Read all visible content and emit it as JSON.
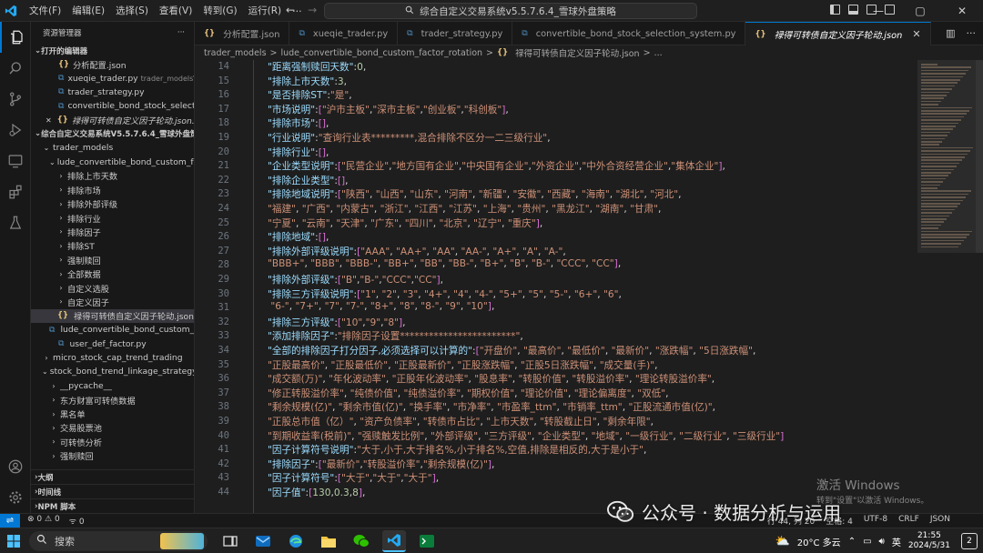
{
  "titlebar": {
    "menus": [
      "文件(F)",
      "编辑(E)",
      "选择(S)",
      "查看(V)",
      "转到(G)",
      "运行(R)"
    ],
    "more": "…",
    "command_center": "综合自定义交易系统v5.5.7.6.4_雪球外盘策略"
  },
  "sidebar": {
    "title": "资源管理器",
    "more": "···",
    "open_editors_label": "打开的编辑器",
    "open_editors": [
      {
        "icon": "json",
        "name": "分析配置.json",
        "hint": ""
      },
      {
        "icon": "py",
        "name": "xueqie_trader.py",
        "hint": "trader_models\\..."
      },
      {
        "icon": "py",
        "name": "trader_strategy.py",
        "hint": ""
      },
      {
        "icon": "py",
        "name": "convertible_bond_stock_selecti...",
        "hint": ""
      },
      {
        "icon": "json",
        "name": "禄得可转债自定义因子轮动.json...",
        "hint": ""
      }
    ],
    "project_label": "综合自定义交易系统V5.5.7.6.4_雪球外盘策略",
    "tree": [
      {
        "level": 1,
        "twisty": "v",
        "name": "trader_models",
        "icon": ""
      },
      {
        "level": 2,
        "twisty": "v",
        "name": "lude_convertible_bond_custom_fac...",
        "icon": ""
      },
      {
        "level": 3,
        "twisty": ">",
        "name": "排除上市天数",
        "icon": ""
      },
      {
        "level": 3,
        "twisty": ">",
        "name": "排除市场",
        "icon": ""
      },
      {
        "level": 3,
        "twisty": ">",
        "name": "排除外部评级",
        "icon": ""
      },
      {
        "level": 3,
        "twisty": ">",
        "name": "排除行业",
        "icon": ""
      },
      {
        "level": 3,
        "twisty": ">",
        "name": "排除因子",
        "icon": ""
      },
      {
        "level": 3,
        "twisty": ">",
        "name": "排除ST",
        "icon": ""
      },
      {
        "level": 3,
        "twisty": ">",
        "name": "强制赎回",
        "icon": ""
      },
      {
        "level": 3,
        "twisty": ">",
        "name": "全部数据",
        "icon": ""
      },
      {
        "level": 3,
        "twisty": ">",
        "name": "自定义选股",
        "icon": ""
      },
      {
        "level": 3,
        "twisty": ">",
        "name": "自定义因子",
        "icon": ""
      },
      {
        "level": 3,
        "twisty": "",
        "name": "禄得可转债自定义因子轮动.json",
        "icon": "json",
        "selected": true
      },
      {
        "level": 2,
        "twisty": "",
        "name": "lude_convertible_bond_custom_fa...",
        "icon": "py"
      },
      {
        "level": 2,
        "twisty": "",
        "name": "user_def_factor.py",
        "icon": "py"
      },
      {
        "level": 1,
        "twisty": ">",
        "name": "micro_stock_cap_trend_trading",
        "icon": ""
      },
      {
        "level": 1,
        "twisty": "v",
        "name": "stock_bond_trend_linkage_strategy",
        "icon": ""
      },
      {
        "level": 2,
        "twisty": ">",
        "name": "__pycache__",
        "icon": ""
      },
      {
        "level": 2,
        "twisty": ">",
        "name": "东方财富可转债数据",
        "icon": ""
      },
      {
        "level": 2,
        "twisty": ">",
        "name": "黑名单",
        "icon": ""
      },
      {
        "level": 2,
        "twisty": ">",
        "name": "交易股票池",
        "icon": ""
      },
      {
        "level": 2,
        "twisty": ">",
        "name": "可转债分析",
        "icon": ""
      },
      {
        "level": 2,
        "twisty": ">",
        "name": "强制赎回",
        "icon": ""
      }
    ],
    "bottom_sections": [
      "大纲",
      "时间线",
      "NPM 脚本"
    ]
  },
  "tabs": [
    {
      "icon": "json",
      "label": "分析配置.json",
      "active": false
    },
    {
      "icon": "py",
      "label": "xueqie_trader.py",
      "active": false
    },
    {
      "icon": "py",
      "label": "trader_strategy.py",
      "active": false
    },
    {
      "icon": "py",
      "label": "convertible_bond_stock_selection_system.py",
      "active": false
    },
    {
      "icon": "json",
      "label": "禄得可转债自定义因子轮动.json",
      "active": true
    }
  ],
  "breadcrumb": [
    "trader_models",
    ">",
    "lude_convertible_bond_custom_factor_rotation",
    ">",
    "禄得可转债自定义因子轮动.json",
    ">",
    "..."
  ],
  "editor": {
    "line_numbers": [
      "14",
      "15",
      "16",
      "17",
      "18",
      "19",
      "20",
      "21",
      "22",
      "23",
      "24",
      "25",
      "26",
      "27",
      "28",
      "29",
      "30",
      "31",
      "32",
      "33",
      "34",
      "35",
      "36",
      "37",
      "38",
      "39",
      "40",
      "41",
      "42",
      "43",
      "44"
    ],
    "lines": [
      "\"距离强制赎回天数\":0,",
      "\"排除上市天数\":3,",
      "\"是否排除ST\":\"是\",",
      "\"市场说明\":[\"沪市主板\",\"深市主板\",\"创业板\",\"科创板\"],",
      "\"排除市场\":[],",
      "\"行业说明\":\"查询行业表*********,混合排除不区分一二三级行业\",",
      "\"排除行业\":[],",
      "\"企业类型说明\":[\"民营企业\",\"地方国有企业\",\"中央国有企业\",\"外资企业\",\"中外合资经营企业\",\"集体企业\"],",
      "\"排除企业类型\":[],",
      "\"排除地域说明\":[\"陕西\", \"山西\", \"山东\", \"河南\", \"新疆\", \"安徽\", \"西藏\", \"海南\", \"湖北\", \"河北\",",
      "\"福建\", \"广西\", \"内蒙古\", \"浙江\", \"江西\", \"江苏\", \"上海\", \"贵州\", \"黑龙江\", \"湖南\", \"甘肃\",",
      "\"宁夏\", \"云南\", \"天津\", \"广东\", \"四川\", \"北京\", \"辽宁\", \"重庆\"],",
      "\"排除地域\":[],",
      "\"排除外部评级说明\":[\"AAA\", \"AA+\", \"AA\", \"AA-\", \"A+\", \"A\", \"A-\",",
      "\"BBB+\", \"BBB\", \"BBB-\", \"BB+\", \"BB\", \"BB-\", \"B+\", \"B\", \"B-\", \"CCC\", \"CC\"],",
      "\"排除外部评级\":[\"B\",\"B-\",\"CCC\",\"CC\"],",
      "\"排除三方评级说明\":[\"1\", \"2\", \"3\", \"4+\", \"4\", \"4-\", \"5+\", \"5\", \"5-\", \"6+\", \"6\",",
      " \"6-\", \"7+\", \"7\", \"7-\", \"8+\", \"8\", \"8-\", \"9\", \"10\"],",
      "\"排除三方评级\":[\"10\",\"9\",\"8\"],",
      "\"添加排除因子\":\"排除因子设置************************\",",
      "\"全部的排除因子打分因子,必须选择可以计算的\":[\"开盘价\", \"最高价\", \"最低价\", \"最新价\", \"涨跌幅\", \"5日涨跌幅\",",
      "\"正股最高价\", \"正股最低价\", \"正股最新价\", \"正股涨跌幅\", \"正股5日涨跌幅\", \"成交量(手)\",",
      "\"成交额(万)\", \"年化波动率\", \"正股年化波动率\", \"股息率\", \"转股价值\", \"转股溢价率\", \"理论转股溢价率\",",
      "\"修正转股溢价率\", \"纯债价值\", \"纯债溢价率\", \"期权价值\", \"理论价值\", \"理论偏离度\", \"双低\",",
      "\"剩余规模(亿)\", \"剩余市值(亿)\", \"换手率\", \"市净率\", \"市盈率_ttm\", \"市销率_ttm\", \"正股流通市值(亿)\",",
      "\"正股总市值（亿）\", \"资产负债率\", \"转债市占比\", \"上市天数\", \"转股截止日\", \"剩余年限\",",
      "\"到期收益率(税前)\", \"强赎触发比例\", \"外部评级\", \"三方评级\", \"企业类型\", \"地域\", \"一级行业\", \"二级行业\", \"三级行业\"]",
      "\"因子计算符号说明\":\"大于,小于,大于排名%,小于排名%,空值,排除是相反的,大于是小于\",",
      "\"排除因子\":[\"最新价\",\"转股溢价率\",\"剩余规模(亿)\"],",
      "\"因子计算符号\":[\"大于\",\"大于\",\"大于\"],",
      "\"因子值\":[130,0.3,8],"
    ]
  },
  "statusbar": {
    "errors": "0",
    "warnings": "0",
    "info": "0",
    "right_items": [
      "行 44, 列 20",
      "空格: 4",
      "UTF-8",
      "CRLF",
      "JSON"
    ]
  },
  "watermark": {
    "activate_title": "激活 Windows",
    "activate_sub": "转到\"设置\"以激活 Windows。",
    "wechat_text": "公众号 · 数据分析与运用"
  },
  "taskbar": {
    "search_placeholder": "搜索",
    "weather": "20°C 多云",
    "ime": "英",
    "time": "21:55",
    "date": "2024/5/31",
    "notifications": "2"
  },
  "colors": {
    "accent": "#0078d4",
    "key": "#9cdcfe",
    "string": "#ce9178",
    "number": "#b5cea8",
    "bracket": "#da70d6"
  }
}
